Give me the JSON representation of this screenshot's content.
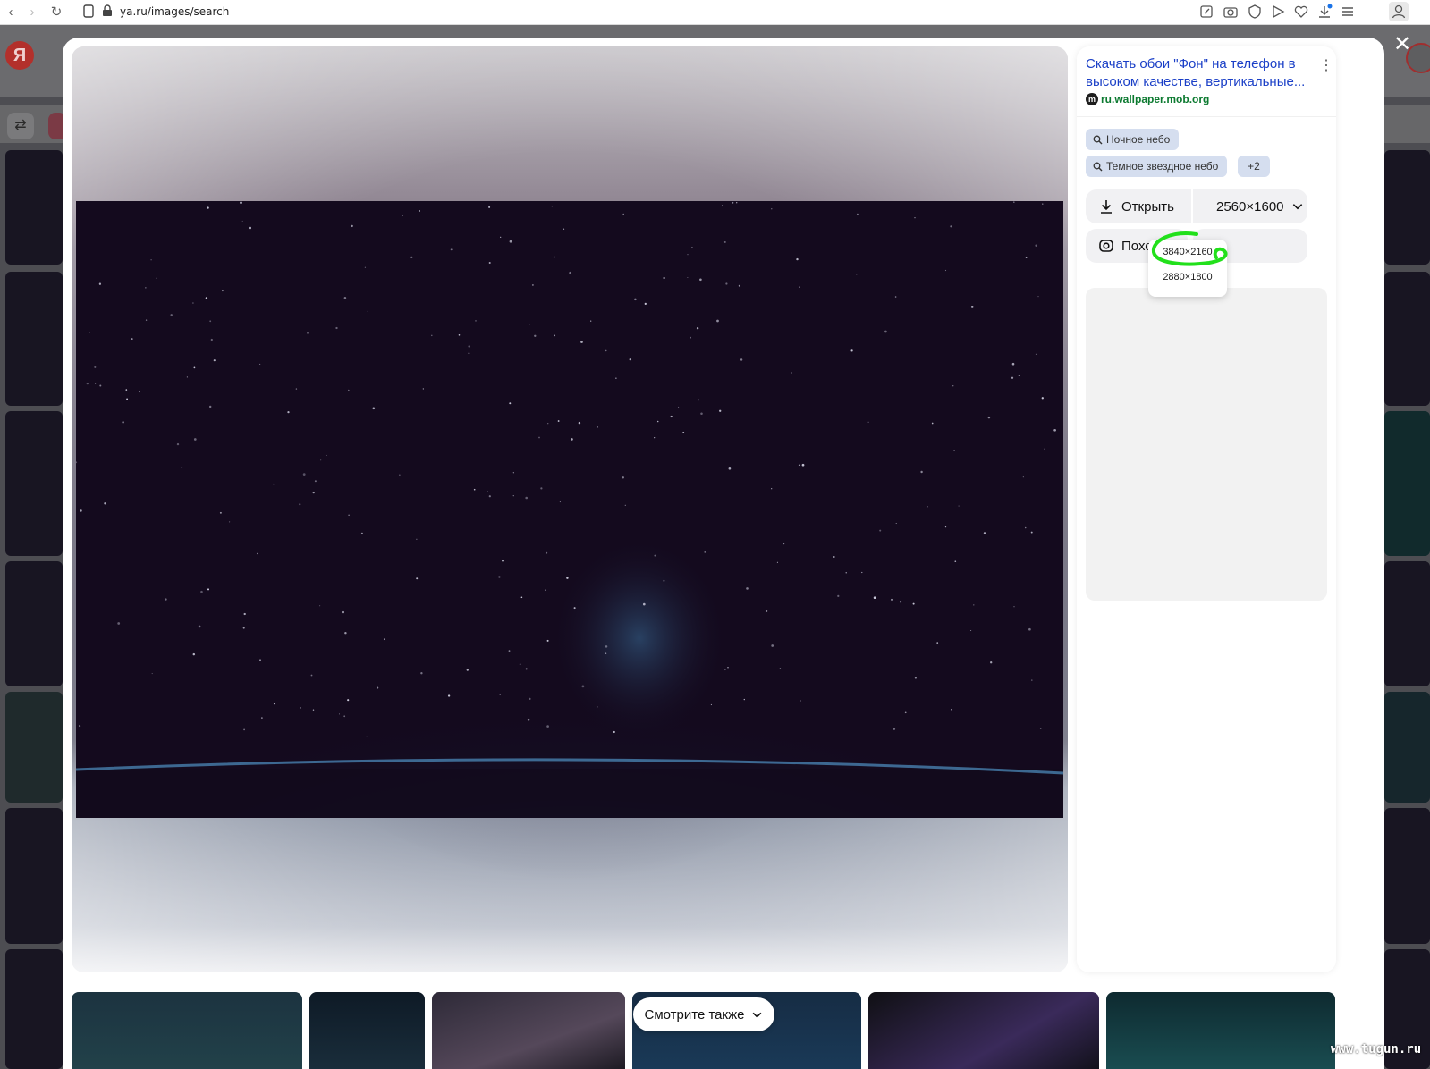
{
  "browser": {
    "url": "ya.ru/images/search",
    "toolbar_icons": [
      "edit-icon",
      "camera-icon",
      "shield-icon",
      "send-icon",
      "heart-icon",
      "download-icon",
      "menu-icon",
      "profile-icon"
    ]
  },
  "background_page": {
    "logo_letter": "Я"
  },
  "modal": {
    "close_glyph": "✕",
    "panel": {
      "title": "Скачать обои \"Фон\" на телефон в высоком качестве, вертикальные...",
      "source_icon_letter": "m",
      "source": "ru.wallpaper.mob.org",
      "tags": [
        "Ночное небо",
        "Темное звездное небо"
      ],
      "more_tags": "+2",
      "open_label": "Открыть",
      "size_label": "2560×1600",
      "similar_label": "Похожие",
      "size_options": [
        "3840×2160",
        "2880×1800"
      ],
      "highlighted_option": "3840×2160",
      "highlight_color": "#22e01b"
    },
    "see_also_label": "Смотрите также"
  },
  "watermark": "www.tugun.ru"
}
